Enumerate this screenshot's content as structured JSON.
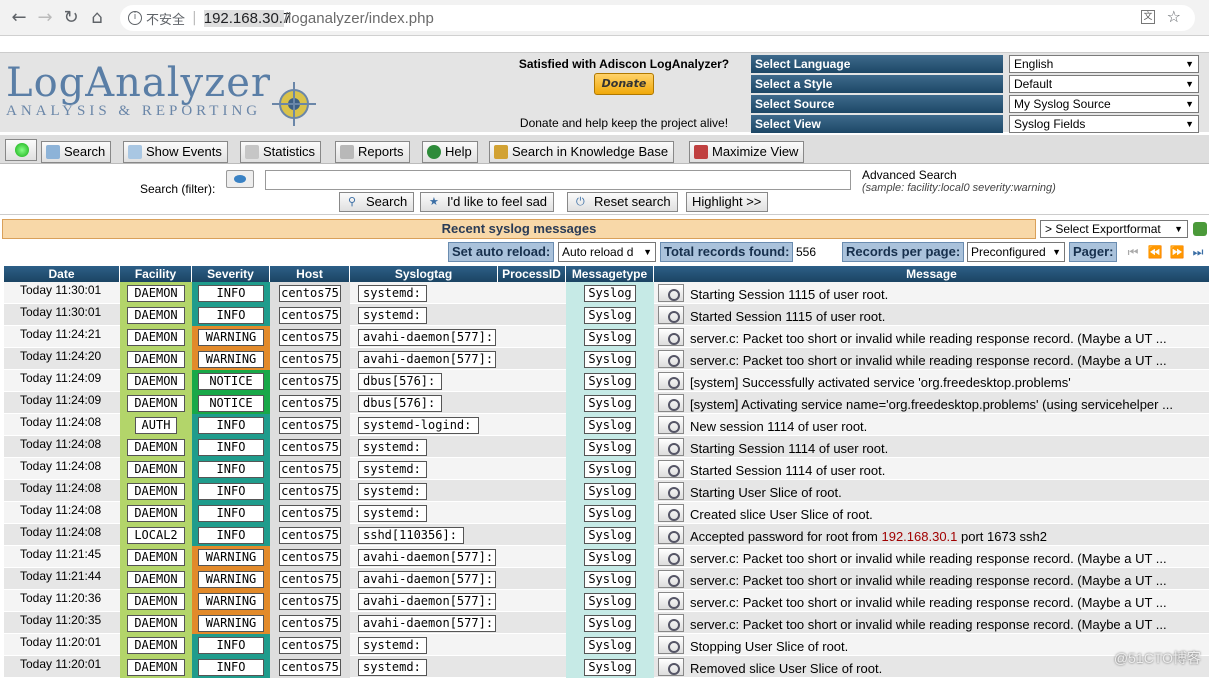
{
  "browser": {
    "security_label": "不安全",
    "url_host": "192.168.30.7",
    "url_path": "/loganalyzer/index.php"
  },
  "header": {
    "logo_title": "LogAnalyzer",
    "logo_subtitle": "ANALYSIS & REPORTING",
    "donate_question": "Satisfied with Adiscon LogAnalyzer?",
    "donate_button": "Donate",
    "donate_note": "Donate and help keep the project alive!",
    "selectors": [
      {
        "label": "Select Language",
        "value": "English"
      },
      {
        "label": "Select a Style",
        "value": "Default"
      },
      {
        "label": "Select Source",
        "value": "My Syslog Source"
      },
      {
        "label": "Select View",
        "value": "Syslog Fields"
      }
    ]
  },
  "menu": {
    "items": [
      {
        "label": "Search"
      },
      {
        "label": "Show Events"
      },
      {
        "label": "Statistics"
      },
      {
        "label": "Reports"
      },
      {
        "label": "Help"
      },
      {
        "label": "Search in Knowledge Base"
      },
      {
        "label": "Maximize View"
      }
    ]
  },
  "search": {
    "label": "Search (filter):",
    "value": "",
    "advanced": "Advanced Search",
    "advanced_sample": "(sample: facility:local0 severity:warning)",
    "buttons": {
      "search": "Search",
      "lucky": "I'd like to feel sad",
      "reset": "Reset search",
      "highlight": "Highlight >>"
    }
  },
  "list": {
    "title": "Recent syslog messages",
    "export": "> Select Exportformat",
    "auto_reload_label": "Set auto reload:",
    "auto_reload_value": "Auto reload d",
    "total_label": "Total records found:",
    "total_value": "556",
    "per_page_label": "Records per page:",
    "per_page_value": "Preconfigured",
    "pager_label": "Pager:"
  },
  "columns": [
    "Date",
    "Facility",
    "Severity",
    "Host",
    "Syslogtag",
    "ProcessID",
    "Messagetype",
    "Message"
  ],
  "colors": {
    "info": "#1f9c8c",
    "warning": "#e28a2a",
    "notice": "#18a848",
    "facility": "#b3d56a",
    "header_blue": "#1d4766"
  },
  "rows": [
    {
      "date": "Today 11:30:01",
      "facility": "DAEMON",
      "severity": "INFO",
      "host": "centos75",
      "tag": "systemd:",
      "type": "Syslog",
      "msg": "Starting Session 1115 of user root."
    },
    {
      "date": "Today 11:30:01",
      "facility": "DAEMON",
      "severity": "INFO",
      "host": "centos75",
      "tag": "systemd:",
      "type": "Syslog",
      "msg": "Started Session 1115 of user root."
    },
    {
      "date": "Today 11:24:21",
      "facility": "DAEMON",
      "severity": "WARNING",
      "host": "centos75",
      "tag": "avahi-daemon[577]:",
      "type": "Syslog",
      "msg": "server.c: Packet too short or invalid while reading response record. (Maybe a UT ..."
    },
    {
      "date": "Today 11:24:20",
      "facility": "DAEMON",
      "severity": "WARNING",
      "host": "centos75",
      "tag": "avahi-daemon[577]:",
      "type": "Syslog",
      "msg": "server.c: Packet too short or invalid while reading response record. (Maybe a UT ..."
    },
    {
      "date": "Today 11:24:09",
      "facility": "DAEMON",
      "severity": "NOTICE",
      "host": "centos75",
      "tag": "dbus[576]:",
      "type": "Syslog",
      "msg": "[system] Successfully activated service 'org.freedesktop.problems'"
    },
    {
      "date": "Today 11:24:09",
      "facility": "DAEMON",
      "severity": "NOTICE",
      "host": "centos75",
      "tag": "dbus[576]:",
      "type": "Syslog",
      "msg": "[system] Activating service name='org.freedesktop.problems' (using servicehelper ..."
    },
    {
      "date": "Today 11:24:08",
      "facility": "AUTH",
      "severity": "INFO",
      "host": "centos75",
      "tag": "systemd-logind:",
      "type": "Syslog",
      "msg": "New session 1114 of user root."
    },
    {
      "date": "Today 11:24:08",
      "facility": "DAEMON",
      "severity": "INFO",
      "host": "centos75",
      "tag": "systemd:",
      "type": "Syslog",
      "msg": "Starting Session 1114 of user root."
    },
    {
      "date": "Today 11:24:08",
      "facility": "DAEMON",
      "severity": "INFO",
      "host": "centos75",
      "tag": "systemd:",
      "type": "Syslog",
      "msg": "Started Session 1114 of user root."
    },
    {
      "date": "Today 11:24:08",
      "facility": "DAEMON",
      "severity": "INFO",
      "host": "centos75",
      "tag": "systemd:",
      "type": "Syslog",
      "msg": "Starting User Slice of root."
    },
    {
      "date": "Today 11:24:08",
      "facility": "DAEMON",
      "severity": "INFO",
      "host": "centos75",
      "tag": "systemd:",
      "type": "Syslog",
      "msg": "Created slice User Slice of root."
    },
    {
      "date": "Today 11:24:08",
      "facility": "LOCAL2",
      "severity": "INFO",
      "host": "centos75",
      "tag": "sshd[110356]:",
      "type": "Syslog",
      "msg_pre": "Accepted password for root from ",
      "msg_ip": "192.168.30.1",
      "msg_post": " port 1673 ssh2"
    },
    {
      "date": "Today 11:21:45",
      "facility": "DAEMON",
      "severity": "WARNING",
      "host": "centos75",
      "tag": "avahi-daemon[577]:",
      "type": "Syslog",
      "msg": "server.c: Packet too short or invalid while reading response record. (Maybe a UT ..."
    },
    {
      "date": "Today 11:21:44",
      "facility": "DAEMON",
      "severity": "WARNING",
      "host": "centos75",
      "tag": "avahi-daemon[577]:",
      "type": "Syslog",
      "msg": "server.c: Packet too short or invalid while reading response record. (Maybe a UT ..."
    },
    {
      "date": "Today 11:20:36",
      "facility": "DAEMON",
      "severity": "WARNING",
      "host": "centos75",
      "tag": "avahi-daemon[577]:",
      "type": "Syslog",
      "msg": "server.c: Packet too short or invalid while reading response record. (Maybe a UT ..."
    },
    {
      "date": "Today 11:20:35",
      "facility": "DAEMON",
      "severity": "WARNING",
      "host": "centos75",
      "tag": "avahi-daemon[577]:",
      "type": "Syslog",
      "msg": "server.c: Packet too short or invalid while reading response record. (Maybe a UT ..."
    },
    {
      "date": "Today 11:20:01",
      "facility": "DAEMON",
      "severity": "INFO",
      "host": "centos75",
      "tag": "systemd:",
      "type": "Syslog",
      "msg": "Stopping User Slice of root."
    },
    {
      "date": "Today 11:20:01",
      "facility": "DAEMON",
      "severity": "INFO",
      "host": "centos75",
      "tag": "systemd:",
      "type": "Syslog",
      "msg": "Removed slice User Slice of root."
    }
  ],
  "watermark": "@51CTO博客"
}
